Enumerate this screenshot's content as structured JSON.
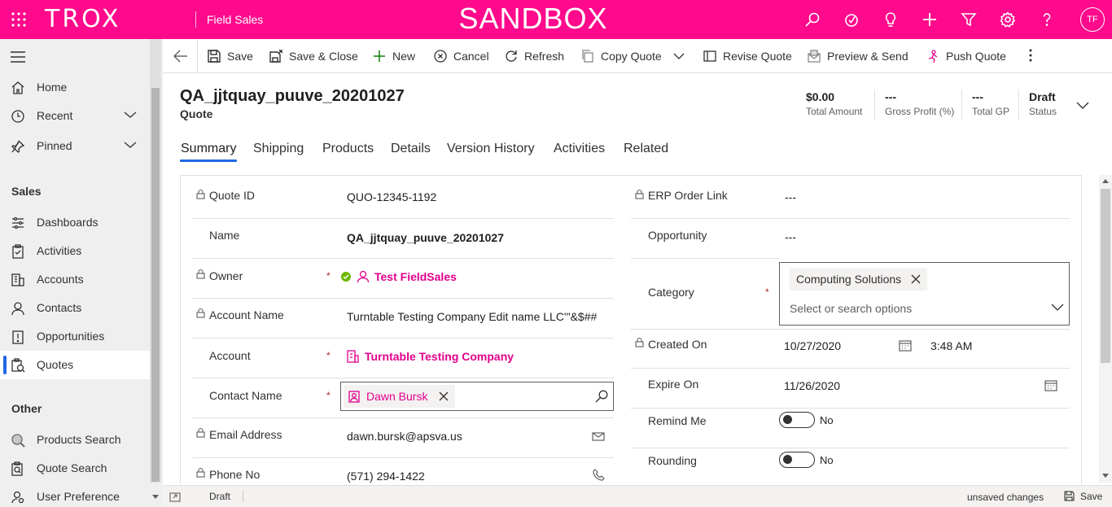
{
  "topbar": {
    "logo": "TROX",
    "app_name": "Field Sales",
    "environment": "SANDBOX",
    "avatar_initials": "TF",
    "color": "#ff0a8c"
  },
  "sidebar": {
    "home": "Home",
    "recent": "Recent",
    "pinned": "Pinned",
    "section_sales": "Sales",
    "items_sales": [
      "Dashboards",
      "Activities",
      "Accounts",
      "Contacts",
      "Opportunities",
      "Quotes"
    ],
    "section_other": "Other",
    "items_other": [
      "Products Search",
      "Quote Search",
      "User Preference"
    ]
  },
  "commands": {
    "save": "Save",
    "save_close": "Save & Close",
    "new": "New",
    "cancel": "Cancel",
    "refresh": "Refresh",
    "copy_quote": "Copy Quote",
    "revise_quote": "Revise Quote",
    "preview_send": "Preview & Send",
    "push_quote": "Push Quote"
  },
  "record": {
    "title": "QA_jjtquay_puuve_20201027",
    "type": "Quote",
    "header_fields": [
      {
        "value": "$0.00",
        "label": "Total Amount"
      },
      {
        "value": "---",
        "label": "Gross Profit (%)"
      },
      {
        "value": "---",
        "label": "Total GP"
      },
      {
        "value": "Draft",
        "label": "Status"
      }
    ]
  },
  "tabs": [
    "Summary",
    "Shipping",
    "Products",
    "Details",
    "Version History",
    "Activities",
    "Related"
  ],
  "form": {
    "left": {
      "quote_id_label": "Quote ID",
      "quote_id": "QUO-12345-1192",
      "name_label": "Name",
      "name": "QA_jjtquay_puuve_20201027",
      "owner_label": "Owner",
      "owner": "Test FieldSales",
      "account_name_label": "Account Name",
      "account_name": "Turntable Testing Company Edit name LLC'\"&$##",
      "account_label": "Account",
      "account": "Turntable Testing Company",
      "contact_label": "Contact Name",
      "contact": "Dawn Bursk",
      "email_label": "Email Address",
      "email": "dawn.bursk@apsva.us",
      "phone_label": "Phone No",
      "phone": "(571) 294-1422",
      "required_mark": "*"
    },
    "right": {
      "erp_label": "ERP Order Link",
      "erp": "---",
      "opportunity_label": "Opportunity",
      "opportunity": "---",
      "category_label": "Category",
      "category_chip": "Computing Solutions",
      "category_placeholder": "Select or search options",
      "created_label": "Created On",
      "created_date": "10/27/2020",
      "created_time": "3:48 AM",
      "expire_label": "Expire On",
      "expire_date": "11/26/2020",
      "remind_label": "Remind Me",
      "remind_value": "No",
      "rounding_label": "Rounding",
      "rounding_value": "No"
    }
  },
  "footer": {
    "status": "Draft",
    "unsaved": "unsaved changes",
    "save": "Save"
  }
}
